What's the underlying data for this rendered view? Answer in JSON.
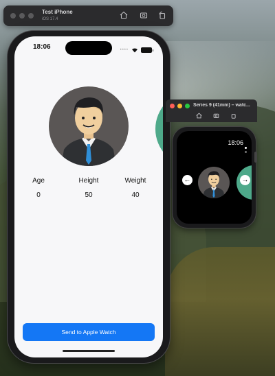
{
  "simulator": {
    "device_name": "Test iPhone",
    "os_version": "iOS 17.4",
    "icons": [
      "home-icon",
      "screenshot-icon",
      "rotate-icon"
    ]
  },
  "phone": {
    "status_time": "18:06",
    "stats": [
      {
        "label": "Age",
        "value": "0"
      },
      {
        "label": "Height",
        "value": "50"
      },
      {
        "label": "Weight",
        "value": "40"
      }
    ],
    "send_button": "Send to Apple Watch",
    "colors": {
      "accent": "#1477f5",
      "peek_avatar": "#4ea98a"
    }
  },
  "watch_simulator": {
    "title": "Series 9 (41mm) – watc...",
    "status_time": "18:06",
    "icons": [
      "home-icon",
      "screenshot-icon",
      "rotate-icon"
    ]
  }
}
